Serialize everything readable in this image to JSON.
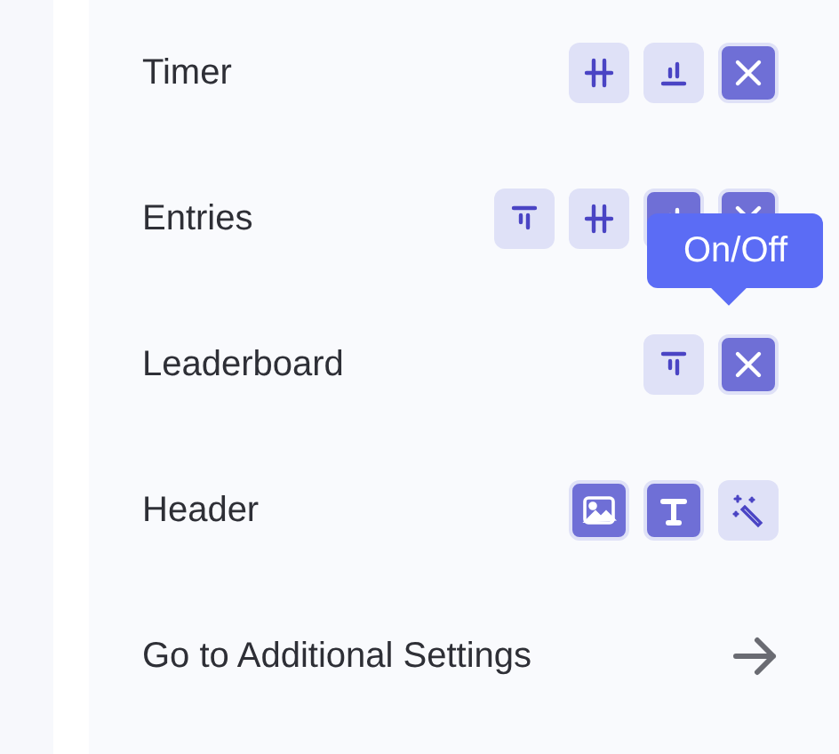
{
  "rows": [
    {
      "label": "Timer",
      "buttons": [
        {
          "kind": "center",
          "selected": false
        },
        {
          "kind": "bottom",
          "selected": false
        },
        {
          "kind": "off",
          "selected": true
        }
      ]
    },
    {
      "label": "Entries",
      "buttons": [
        {
          "kind": "top",
          "selected": false
        },
        {
          "kind": "center",
          "selected": false
        },
        {
          "kind": "bottom",
          "selected": true
        },
        {
          "kind": "off",
          "selected": true
        }
      ],
      "tooltip": "On/Off"
    },
    {
      "label": "Leaderboard",
      "buttons": [
        {
          "kind": "top",
          "selected": false
        },
        {
          "kind": "off",
          "selected": true
        }
      ]
    },
    {
      "label": "Header",
      "buttons": [
        {
          "kind": "image",
          "selected": true
        },
        {
          "kind": "text",
          "selected": true
        },
        {
          "kind": "magic",
          "selected": false
        }
      ]
    }
  ],
  "link": {
    "label": "Go to Additional Settings"
  }
}
